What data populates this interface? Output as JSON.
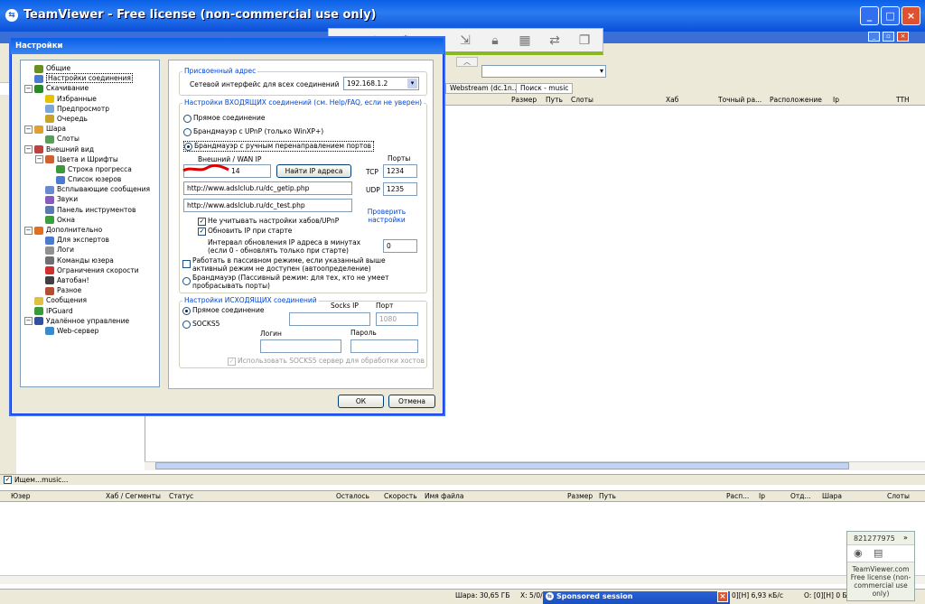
{
  "tv": {
    "title": "TeamViewer - Free license (non-commercial use only)",
    "logo": "tv-logo-icon",
    "minimize": "_",
    "maximize": "□",
    "close": "×",
    "toolbar_icons": [
      "record-icon",
      "refresh-icon",
      "gear-icon",
      "chat-icon",
      "transfer-icon",
      "lock-icon",
      "windows-icon",
      "switch-sides-icon",
      "fullscreen-icon"
    ],
    "collapse": "︿",
    "panel": {
      "id": "821277975",
      "collapse": "»",
      "info": "TeamViewer.com Free license (non-commercial use only)"
    }
  },
  "app": {
    "tabs": [
      "Webstream (dc.1n...",
      "Поиск - music"
    ],
    "results_columns": [
      "Размер",
      "Путь",
      "Слоты",
      "Хаб",
      "Точный ра...",
      "Расположение",
      "Ip",
      "TTH"
    ],
    "search_label": "Ищем...music...",
    "transfer_columns": [
      "Юзер",
      "Хаб / Сегменты",
      "Статус",
      "Осталось",
      "Скорость",
      "Имя файла",
      "Размер",
      "Путь",
      "Расп...",
      "Ip",
      "Отд...",
      "Шара",
      "Слоты"
    ],
    "status": {
      "share": "Шара: 30,65 ГБ",
      "x": "X: 5/0/",
      "sponsored": "Sponsored session",
      "speed": "0][Н] 6,93 кБ/с",
      "o": "О: [0][Н] 0 Б"
    }
  },
  "dialog": {
    "title": "Настройки",
    "tree": [
      {
        "label": "Общие",
        "level": 1,
        "icon": "general-icon",
        "color": "#6b8e23"
      },
      {
        "label": "Настройки соединения",
        "level": 1,
        "icon": "connection-icon",
        "color": "#4a7bd0",
        "selected": true
      },
      {
        "label": "Скачивание",
        "level": 1,
        "icon": "download-icon",
        "color": "#2a8a2a",
        "expander": "−"
      },
      {
        "label": "Избранные",
        "level": 2,
        "icon": "star-icon",
        "color": "#e6c200"
      },
      {
        "label": "Предпросмотр",
        "level": 2,
        "icon": "preview-icon",
        "color": "#7aa6d8"
      },
      {
        "label": "Очередь",
        "level": 2,
        "icon": "queue-icon",
        "color": "#c9a227"
      },
      {
        "label": "Шара",
        "level": 1,
        "icon": "share-icon",
        "color": "#e0a030",
        "expander": "−"
      },
      {
        "label": "Слоты",
        "level": 2,
        "icon": "slots-icon",
        "color": "#5a9c5a"
      },
      {
        "label": "Внешний вид",
        "level": 1,
        "icon": "appearance-icon",
        "color": "#c04040",
        "expander": "−"
      },
      {
        "label": "Цвета и Шрифты",
        "level": 2,
        "icon": "palette-icon",
        "color": "#d06030",
        "expander": "−"
      },
      {
        "label": "Строка прогресса",
        "level": 3,
        "icon": "progress-icon",
        "color": "#3a9a3a"
      },
      {
        "label": "Список юзеров",
        "level": 3,
        "icon": "users-icon",
        "color": "#4a7bd0"
      },
      {
        "label": "Всплывающие сообщения",
        "level": 2,
        "icon": "popup-icon",
        "color": "#6a8ad0"
      },
      {
        "label": "Звуки",
        "level": 2,
        "icon": "sound-icon",
        "color": "#8a5ac0"
      },
      {
        "label": "Панель инструментов",
        "level": 2,
        "icon": "toolbar-icon",
        "color": "#5a7ab0"
      },
      {
        "label": "Окна",
        "level": 2,
        "icon": "windows-icon",
        "color": "#3aa03a"
      },
      {
        "label": "Дополнительно",
        "level": 1,
        "icon": "advanced-icon",
        "color": "#e07020",
        "expander": "−"
      },
      {
        "label": "Для экспертов",
        "level": 2,
        "icon": "expert-icon",
        "color": "#4a7bd0"
      },
      {
        "label": "Логи",
        "level": 2,
        "icon": "logs-icon",
        "color": "#909090"
      },
      {
        "label": "Команды юзера",
        "level": 2,
        "icon": "commands-icon",
        "color": "#707070"
      },
      {
        "label": "Ограничения скорости",
        "level": 2,
        "icon": "speed-limit-icon",
        "color": "#d03030"
      },
      {
        "label": "Автобан!",
        "level": 2,
        "icon": "autoban-icon",
        "color": "#404040"
      },
      {
        "label": "Разное",
        "level": 2,
        "icon": "misc-icon",
        "color": "#b05030"
      },
      {
        "label": "Сообщения",
        "level": 1,
        "icon": "messages-icon",
        "color": "#e0c040"
      },
      {
        "label": "IPGuard",
        "level": 1,
        "icon": "ipguard-icon",
        "color": "#3a9a3a"
      },
      {
        "label": "Удалённое управление",
        "level": 1,
        "icon": "remote-control-icon",
        "color": "#3050a0",
        "expander": "−"
      },
      {
        "label": "Web-сервер",
        "level": 2,
        "icon": "web-server-icon",
        "color": "#3a8ad0"
      }
    ],
    "assigned": {
      "legend": "Присвоенный адрес",
      "label": "Сетевой интерфейс для всех соединений",
      "value": "192.168.1.2"
    },
    "incoming": {
      "legend": "Настройки ВХОДЯЩИХ соединений (см. Help/FAQ, если не уверен)",
      "radio_direct": "Прямое соединение",
      "radio_upnp": "Брандмауэр с UPnP (только WinXP+)",
      "radio_manual": "Брандмауэр с ручным перенаправлением портов",
      "wan_label": "Внешний / WAN IP",
      "wan_value": "14",
      "find_ip": "Найти IP адреса",
      "ports_label": "Порты",
      "tcp_label": "TCP",
      "tcp_value": "1234",
      "udp_label": "UDP",
      "udp_value": "1235",
      "url1": "http://www.adslclub.ru/dc_getip.php",
      "url2": "http://www.adslclub.ru/dc_test.php",
      "check_link": "Проверить настройки",
      "ignore_hubs": "Не учитывать настройки хабов/UPnP",
      "update_ip": "Обновить IP при старте",
      "interval_label": "Интервал обновления IP адреса в минутах (если 0 - обновлять только при старте)",
      "interval_value": "0",
      "passive_check": "Работать в пассивном режиме, если указанный выше активный режим не доступен (автоопределение)",
      "radio_passive": "Брандмауэр (Пассивный режим: для тех, кто не умеет пробрасывать порты)"
    },
    "outgoing": {
      "legend": "Настройки ИСХОДЯЩИХ соединений",
      "radio_direct": "Прямое соединение",
      "radio_socks": "SOCKS5",
      "socks_ip_label": "Socks IP",
      "port_label": "Порт",
      "port_value": "1080",
      "login_label": "Логин",
      "password_label": "Пароль",
      "use_socks": "Использовать SOCKS5 сервер для обработки хостов"
    },
    "ok": "ОК",
    "cancel": "Отмена"
  }
}
